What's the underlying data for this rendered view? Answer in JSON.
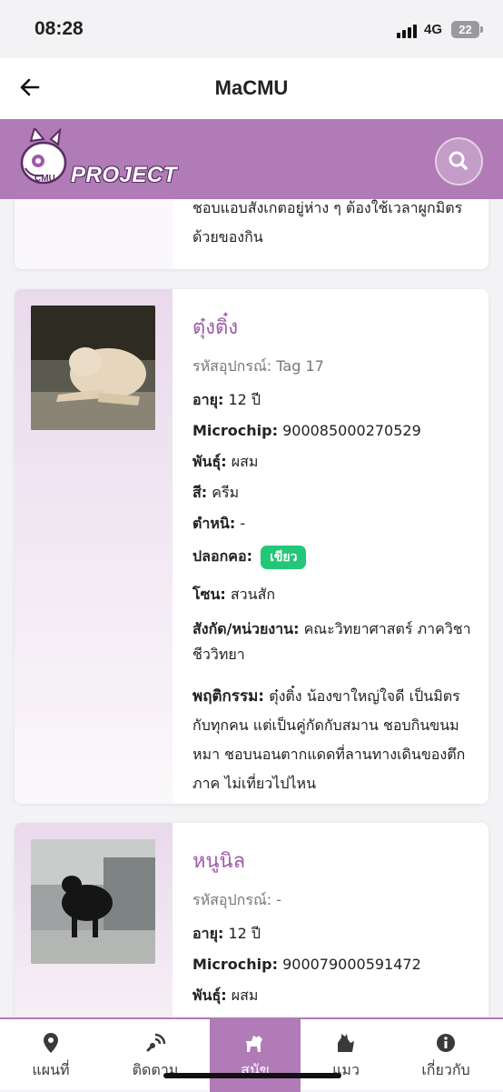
{
  "status": {
    "time": "08:28",
    "network": "4G",
    "battery": "22"
  },
  "navbar": {
    "title": "MaCMU"
  },
  "brand": {
    "logo_text": "PROJECT",
    "logo_small": "CMU"
  },
  "colors": {
    "accent": "#b07bb6",
    "collar_green": "#22c777"
  },
  "previous_card": {
    "behavior_tail": "ชอบแอบสังเกตอยู่ห่าง ๆ ต้องใช้เวลาผูกมิตรด้วยของกิน"
  },
  "dogs": [
    {
      "name": "ตุ๋งติ๋ง",
      "device": "รหัสอุปกรณ์: Tag 17",
      "age_label": "อายุ:",
      "age": "12 ปี",
      "chip_label": "Microchip:",
      "chip": "900085000270529",
      "breed_label": "พันธุ์:",
      "breed": "ผสม",
      "color_label": "สี:",
      "color": "ครีม",
      "mark_label": "ตำหนิ:",
      "mark": "-",
      "collar_label": "ปลอกคอ:",
      "collar": "เขียว",
      "zone_label": "โซน:",
      "zone": "สวนสัก",
      "dept_label": "สังกัด/หน่วยงาน:",
      "dept": "คณะวิทยาศาสตร์ ภาควิชาชีววิทยา",
      "behavior_label": "พฤติกรรม:",
      "behavior": "ตุ๋งติ๋ง น้องขาใหญ่ใจดี เป็นมิตรกับทุกคน แต่เป็นคู่กัดกับสมาน ชอบกินขนมหมา ชอบนอนตากแดดที่ลานทางเดินของตึกภาค ไม่เที่ยวไปไหน"
    },
    {
      "name": "หนูนิล",
      "device": "รหัสอุปกรณ์: -",
      "age_label": "อายุ:",
      "age": "12 ปี",
      "chip_label": "Microchip:",
      "chip": "900079000591472",
      "breed_label": "พันธุ์:",
      "breed": "ผสม"
    }
  ],
  "tabs": [
    {
      "label": "แผนที่",
      "icon": "map-pin-icon"
    },
    {
      "label": "ติดตาม",
      "icon": "tracking-icon"
    },
    {
      "label": "สุนัข",
      "icon": "dog-icon"
    },
    {
      "label": "แมว",
      "icon": "cat-icon"
    },
    {
      "label": "เกี่ยวกับ",
      "icon": "info-icon"
    }
  ]
}
